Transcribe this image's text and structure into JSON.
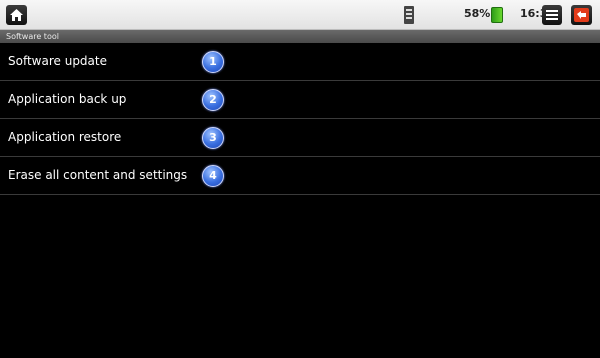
{
  "status_bar": {
    "battery_percent": "58%",
    "time": "16:30",
    "icons": [
      "home-icon",
      "wifi-signal-icon",
      "battery-icon",
      "menu-icon",
      "back-icon"
    ],
    "colors": {
      "battery": "#4cc223",
      "bar": "#e8e8e8"
    }
  },
  "title": "Software tool",
  "items": [
    {
      "label": "Software update",
      "number": "1"
    },
    {
      "label": "Application back up",
      "number": "2"
    },
    {
      "label": "Application restore",
      "number": "3"
    },
    {
      "label": "Erase all content and settings",
      "number": "4"
    }
  ],
  "colors": {
    "background": "#000000",
    "badge": "#3a6fe0",
    "text": "#ffffff"
  }
}
